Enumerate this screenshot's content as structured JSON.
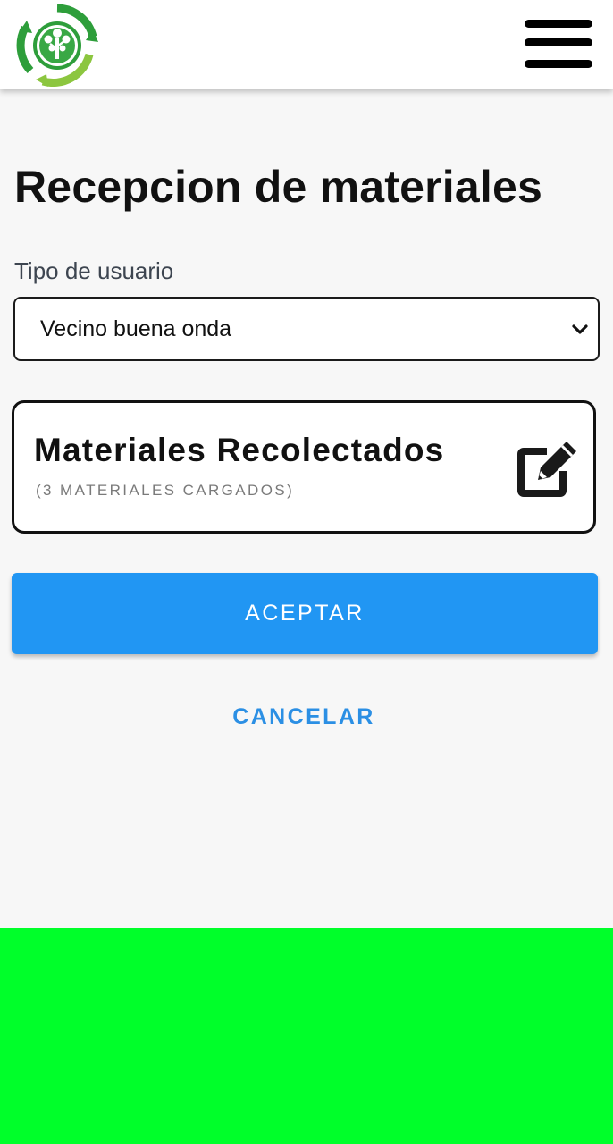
{
  "header": {
    "logo_icon": "recycle-tree-logo",
    "menu_icon": "hamburger-menu-icon"
  },
  "main": {
    "title": "Recepcion de materiales",
    "user_type": {
      "label": "Tipo de usuario",
      "selected": "Vecino buena onda"
    },
    "materials_card": {
      "title": "Materiales Recolectados",
      "subtitle": "(3 MATERIALES CARGADOS)",
      "icon": "edit-icon"
    },
    "accept_label": "ACEPTAR",
    "cancel_label": "CANCELAR"
  },
  "colors": {
    "primary": "#2196f3",
    "bottom_bar": "#00ff2a",
    "logo_green_dark": "#2e9e3b",
    "logo_green_light": "#8cc63f"
  }
}
